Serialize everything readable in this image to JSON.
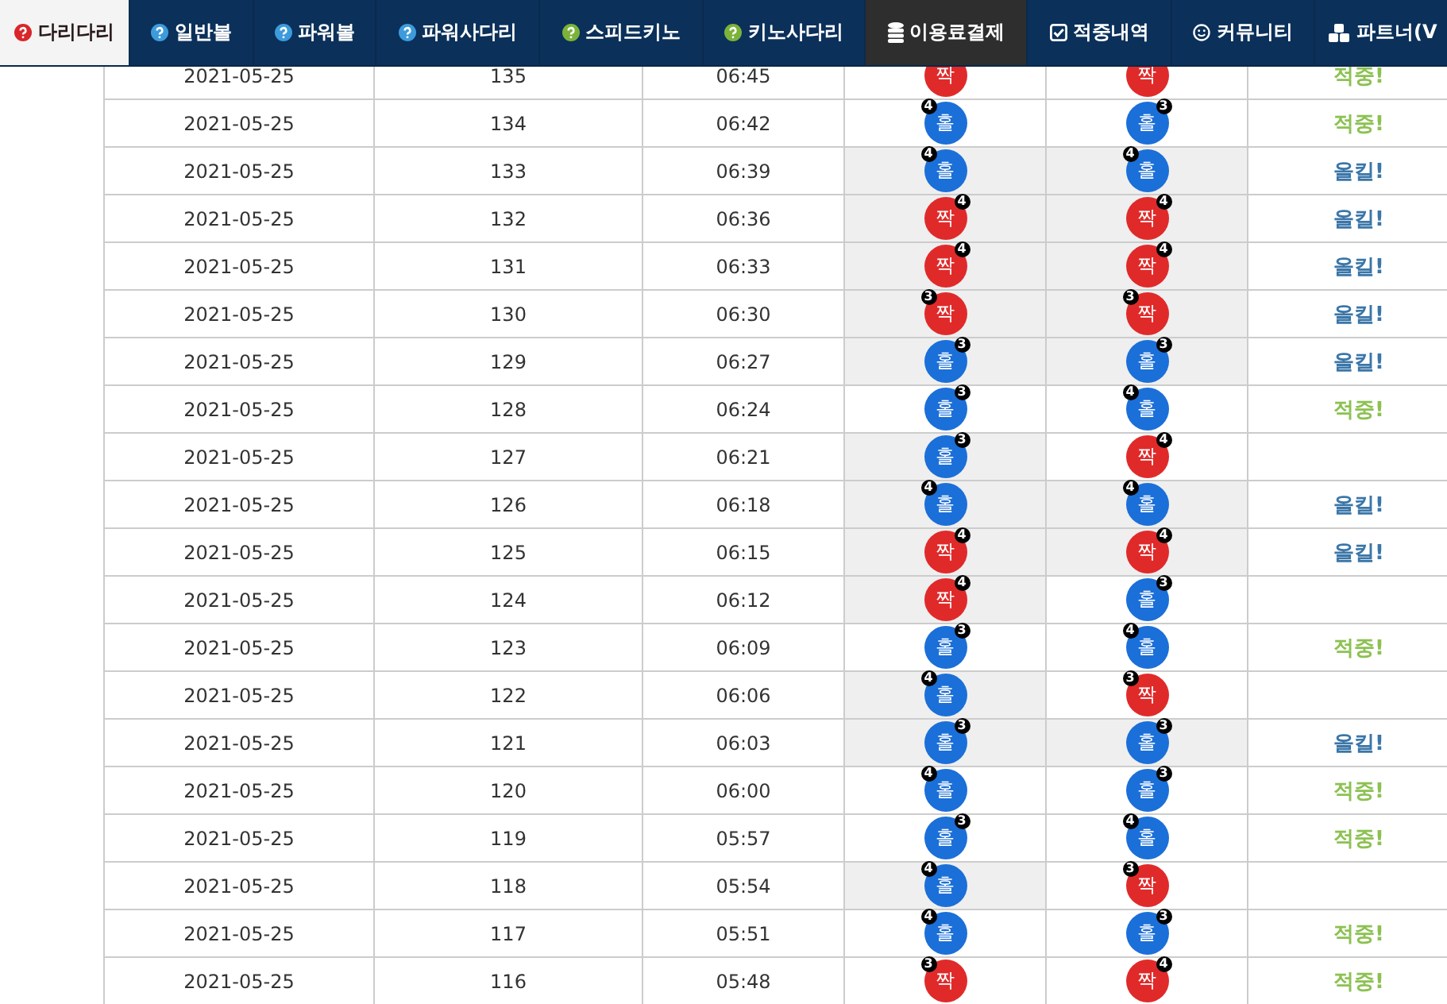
{
  "nav": {
    "tabs": [
      {
        "label": "다리다리",
        "kind": "help",
        "color": "#d9262b",
        "selected": true,
        "highlighted": false
      },
      {
        "label": "일반볼",
        "kind": "help",
        "color": "#3d9bdc",
        "selected": false,
        "highlighted": false
      },
      {
        "label": "파워볼",
        "kind": "help",
        "color": "#3d9bdc",
        "selected": false,
        "highlighted": false
      },
      {
        "label": "파워사다리",
        "kind": "help",
        "color": "#3d9bdc",
        "selected": false,
        "highlighted": false
      },
      {
        "label": "스피드키노",
        "kind": "help",
        "color": "#7bb33a",
        "selected": false,
        "highlighted": false
      },
      {
        "label": "키노사다리",
        "kind": "help",
        "color": "#7bb33a",
        "selected": false,
        "highlighted": false
      },
      {
        "label": "이용료결제",
        "kind": "database",
        "selected": false,
        "highlighted": true
      },
      {
        "label": "적중내역",
        "kind": "check",
        "selected": false,
        "highlighted": false
      },
      {
        "label": "커뮤니티",
        "kind": "smile",
        "selected": false,
        "highlighted": false
      },
      {
        "label": "파트너(V",
        "kind": "cubes",
        "selected": false,
        "highlighted": false
      }
    ]
  },
  "rows": [
    {
      "date": "2021-05-25",
      "round": "135",
      "time": "06:45",
      "balls": [
        {
          "kind": "even",
          "label": "짝",
          "shaded": false
        },
        {
          "kind": "even",
          "label": "짝",
          "shaded": false
        }
      ],
      "result": {
        "kind": "hit",
        "text": "적중!"
      }
    },
    {
      "date": "2021-05-25",
      "round": "134",
      "time": "06:42",
      "balls": [
        {
          "kind": "odd",
          "label": "홀",
          "badge": "4",
          "badge_left": true,
          "shaded": false
        },
        {
          "kind": "odd",
          "label": "홀",
          "badge": "3",
          "badge_left": false,
          "shaded": false
        }
      ],
      "result": {
        "kind": "hit",
        "text": "적중!"
      }
    },
    {
      "date": "2021-05-25",
      "round": "133",
      "time": "06:39",
      "balls": [
        {
          "kind": "odd",
          "label": "홀",
          "badge": "4",
          "badge_left": true,
          "shaded": true
        },
        {
          "kind": "odd",
          "label": "홀",
          "badge": "4",
          "badge_left": true,
          "shaded": true
        }
      ],
      "result": {
        "kind": "allkill",
        "text": "올킬!"
      }
    },
    {
      "date": "2021-05-25",
      "round": "132",
      "time": "06:36",
      "balls": [
        {
          "kind": "even",
          "label": "짝",
          "badge": "4",
          "badge_left": false,
          "shaded": true
        },
        {
          "kind": "even",
          "label": "짝",
          "badge": "4",
          "badge_left": false,
          "shaded": true
        }
      ],
      "result": {
        "kind": "allkill",
        "text": "올킬!"
      }
    },
    {
      "date": "2021-05-25",
      "round": "131",
      "time": "06:33",
      "balls": [
        {
          "kind": "even",
          "label": "짝",
          "badge": "4",
          "badge_left": false,
          "shaded": true
        },
        {
          "kind": "even",
          "label": "짝",
          "badge": "4",
          "badge_left": false,
          "shaded": true
        }
      ],
      "result": {
        "kind": "allkill",
        "text": "올킬!"
      }
    },
    {
      "date": "2021-05-25",
      "round": "130",
      "time": "06:30",
      "balls": [
        {
          "kind": "even",
          "label": "짝",
          "badge": "3",
          "badge_left": true,
          "shaded": true
        },
        {
          "kind": "even",
          "label": "짝",
          "badge": "3",
          "badge_left": true,
          "shaded": true
        }
      ],
      "result": {
        "kind": "allkill",
        "text": "올킬!"
      }
    },
    {
      "date": "2021-05-25",
      "round": "129",
      "time": "06:27",
      "balls": [
        {
          "kind": "odd",
          "label": "홀",
          "badge": "3",
          "badge_left": false,
          "shaded": true
        },
        {
          "kind": "odd",
          "label": "홀",
          "badge": "3",
          "badge_left": false,
          "shaded": true
        }
      ],
      "result": {
        "kind": "allkill",
        "text": "올킬!"
      }
    },
    {
      "date": "2021-05-25",
      "round": "128",
      "time": "06:24",
      "balls": [
        {
          "kind": "odd",
          "label": "홀",
          "badge": "3",
          "badge_left": false,
          "shaded": false
        },
        {
          "kind": "odd",
          "label": "홀",
          "badge": "4",
          "badge_left": true,
          "shaded": false
        }
      ],
      "result": {
        "kind": "hit",
        "text": "적중!"
      }
    },
    {
      "date": "2021-05-25",
      "round": "127",
      "time": "06:21",
      "balls": [
        {
          "kind": "odd",
          "label": "홀",
          "badge": "3",
          "badge_left": false,
          "shaded": true
        },
        {
          "kind": "even",
          "label": "짝",
          "badge": "4",
          "badge_left": false,
          "shaded": false
        }
      ]
    },
    {
      "date": "2021-05-25",
      "round": "126",
      "time": "06:18",
      "balls": [
        {
          "kind": "odd",
          "label": "홀",
          "badge": "4",
          "badge_left": true,
          "shaded": true
        },
        {
          "kind": "odd",
          "label": "홀",
          "badge": "4",
          "badge_left": true,
          "shaded": true
        }
      ],
      "result": {
        "kind": "allkill",
        "text": "올킬!"
      }
    },
    {
      "date": "2021-05-25",
      "round": "125",
      "time": "06:15",
      "balls": [
        {
          "kind": "even",
          "label": "짝",
          "badge": "4",
          "badge_left": false,
          "shaded": true
        },
        {
          "kind": "even",
          "label": "짝",
          "badge": "4",
          "badge_left": false,
          "shaded": true
        }
      ],
      "result": {
        "kind": "allkill",
        "text": "올킬!"
      }
    },
    {
      "date": "2021-05-25",
      "round": "124",
      "time": "06:12",
      "balls": [
        {
          "kind": "even",
          "label": "짝",
          "badge": "4",
          "badge_left": false,
          "shaded": true
        },
        {
          "kind": "odd",
          "label": "홀",
          "badge": "3",
          "badge_left": false,
          "shaded": false
        }
      ]
    },
    {
      "date": "2021-05-25",
      "round": "123",
      "time": "06:09",
      "balls": [
        {
          "kind": "odd",
          "label": "홀",
          "badge": "3",
          "badge_left": false,
          "shaded": false
        },
        {
          "kind": "odd",
          "label": "홀",
          "badge": "4",
          "badge_left": true,
          "shaded": false
        }
      ],
      "result": {
        "kind": "hit",
        "text": "적중!"
      }
    },
    {
      "date": "2021-05-25",
      "round": "122",
      "time": "06:06",
      "balls": [
        {
          "kind": "odd",
          "label": "홀",
          "badge": "4",
          "badge_left": true,
          "shaded": true
        },
        {
          "kind": "even",
          "label": "짝",
          "badge": "3",
          "badge_left": true,
          "shaded": false
        }
      ]
    },
    {
      "date": "2021-05-25",
      "round": "121",
      "time": "06:03",
      "balls": [
        {
          "kind": "odd",
          "label": "홀",
          "badge": "3",
          "badge_left": false,
          "shaded": true
        },
        {
          "kind": "odd",
          "label": "홀",
          "badge": "3",
          "badge_left": false,
          "shaded": true
        }
      ],
      "result": {
        "kind": "allkill",
        "text": "올킬!"
      }
    },
    {
      "date": "2021-05-25",
      "round": "120",
      "time": "06:00",
      "balls": [
        {
          "kind": "odd",
          "label": "홀",
          "badge": "4",
          "badge_left": true,
          "shaded": false
        },
        {
          "kind": "odd",
          "label": "홀",
          "badge": "3",
          "badge_left": false,
          "shaded": false
        }
      ],
      "result": {
        "kind": "hit",
        "text": "적중!"
      }
    },
    {
      "date": "2021-05-25",
      "round": "119",
      "time": "05:57",
      "balls": [
        {
          "kind": "odd",
          "label": "홀",
          "badge": "3",
          "badge_left": false,
          "shaded": false
        },
        {
          "kind": "odd",
          "label": "홀",
          "badge": "4",
          "badge_left": true,
          "shaded": false
        }
      ],
      "result": {
        "kind": "hit",
        "text": "적중!"
      }
    },
    {
      "date": "2021-05-25",
      "round": "118",
      "time": "05:54",
      "balls": [
        {
          "kind": "odd",
          "label": "홀",
          "badge": "4",
          "badge_left": true,
          "shaded": true
        },
        {
          "kind": "even",
          "label": "짝",
          "badge": "3",
          "badge_left": true,
          "shaded": false
        }
      ]
    },
    {
      "date": "2021-05-25",
      "round": "117",
      "time": "05:51",
      "balls": [
        {
          "kind": "odd",
          "label": "홀",
          "badge": "4",
          "badge_left": true,
          "shaded": false
        },
        {
          "kind": "odd",
          "label": "홀",
          "badge": "3",
          "badge_left": false,
          "shaded": false
        }
      ],
      "result": {
        "kind": "hit",
        "text": "적중!"
      }
    },
    {
      "date": "2021-05-25",
      "round": "116",
      "time": "05:48",
      "balls": [
        {
          "kind": "even",
          "label": "짝",
          "badge": "3",
          "badge_left": true,
          "shaded": false
        },
        {
          "kind": "even",
          "label": "짝",
          "badge": "4",
          "badge_left": false,
          "shaded": false
        }
      ],
      "result": {
        "kind": "hit",
        "text": "적중!"
      }
    }
  ]
}
